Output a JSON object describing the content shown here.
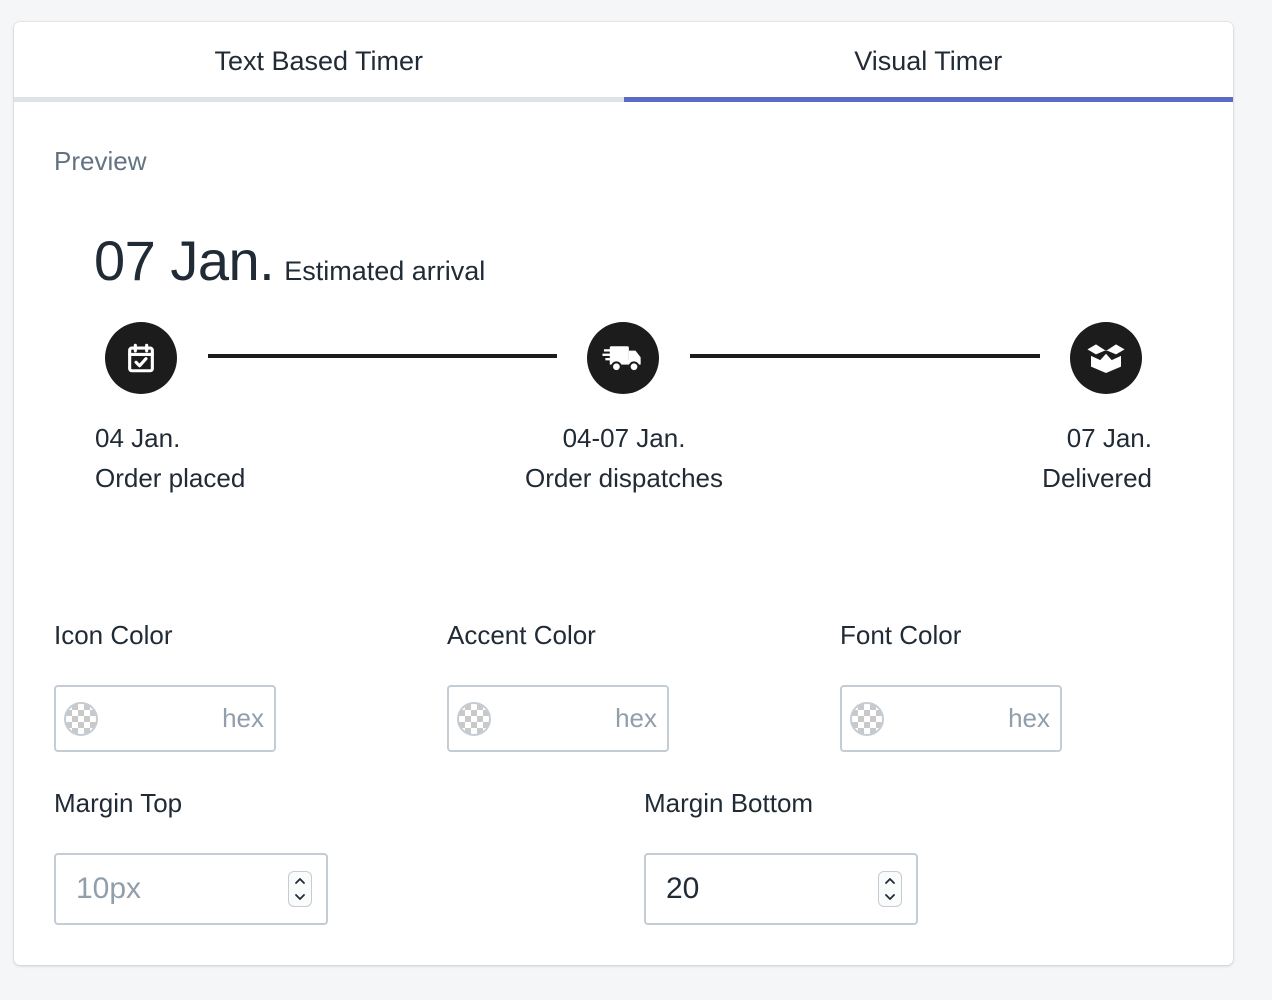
{
  "tabs": [
    {
      "label": "Text Based Timer",
      "active": false
    },
    {
      "label": "Visual Timer",
      "active": true
    }
  ],
  "preview": {
    "label": "Preview",
    "estimated_date": "07 Jan.",
    "estimated_text": "Estimated arrival",
    "steps": [
      {
        "date": "04 Jan.",
        "label": "Order placed",
        "icon": "calendar-check-icon"
      },
      {
        "date": "04-07 Jan.",
        "label": "Order dispatches",
        "icon": "truck-icon"
      },
      {
        "date": "07 Jan.",
        "label": "Delivered",
        "icon": "box-icon"
      }
    ]
  },
  "settings": {
    "icon_color": {
      "label": "Icon Color",
      "placeholder": "hex",
      "value": ""
    },
    "accent_color": {
      "label": "Accent Color",
      "placeholder": "hex",
      "value": ""
    },
    "font_color": {
      "label": "Font Color",
      "placeholder": "hex",
      "value": ""
    },
    "margin_top": {
      "label": "Margin Top",
      "placeholder": "10px",
      "value": ""
    },
    "margin_bottom": {
      "label": "Margin Bottom",
      "placeholder": "",
      "value": "20"
    }
  },
  "colors": {
    "accent": "#5c6ac4",
    "icon_background": "#1c1c1c",
    "tab_inactive_underline": "#dfe3e8"
  }
}
